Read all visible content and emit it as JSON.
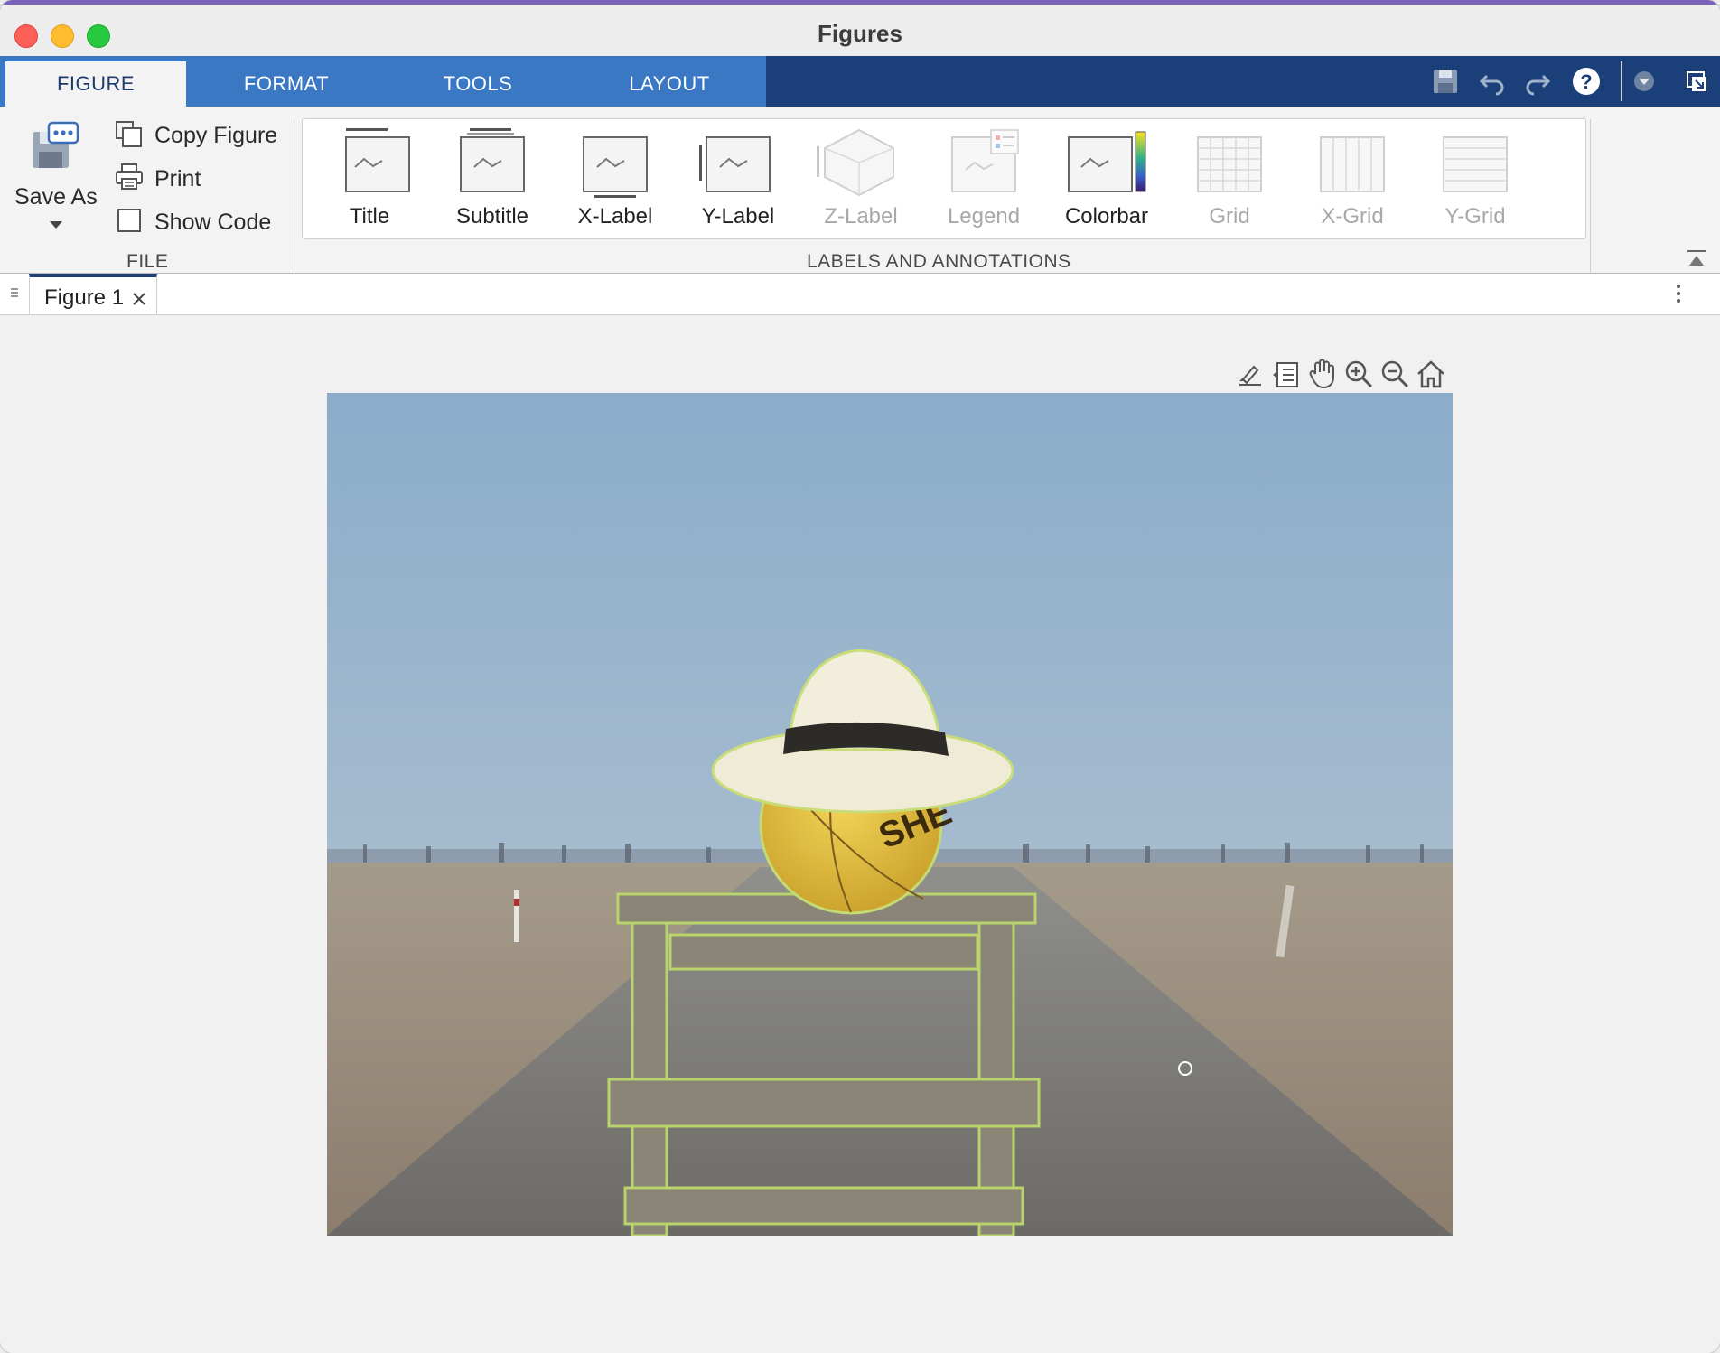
{
  "window": {
    "title": "Figures"
  },
  "tabs": [
    {
      "label": "FIGURE",
      "active": true
    },
    {
      "label": "FORMAT",
      "active": false
    },
    {
      "label": "TOOLS",
      "active": false
    },
    {
      "label": "LAYOUT",
      "active": false
    }
  ],
  "file_section": {
    "label": "FILE",
    "save_as": "Save As",
    "copy_figure": "Copy Figure",
    "print": "Print",
    "show_code": "Show Code",
    "show_code_checked": false
  },
  "labels_section": {
    "label": "LABELS AND ANNOTATIONS",
    "items": [
      {
        "label": "Title",
        "enabled": true,
        "icon": "title-icon"
      },
      {
        "label": "Subtitle",
        "enabled": true,
        "icon": "subtitle-icon"
      },
      {
        "label": "X-Label",
        "enabled": true,
        "icon": "xlabel-icon"
      },
      {
        "label": "Y-Label",
        "enabled": true,
        "icon": "ylabel-icon"
      },
      {
        "label": "Z-Label",
        "enabled": false,
        "icon": "zlabel-icon"
      },
      {
        "label": "Legend",
        "enabled": false,
        "icon": "legend-icon"
      },
      {
        "label": "Colorbar",
        "enabled": true,
        "icon": "colorbar-icon"
      },
      {
        "label": "Grid",
        "enabled": false,
        "icon": "grid-icon"
      },
      {
        "label": "X-Grid",
        "enabled": false,
        "icon": "xgrid-icon"
      },
      {
        "label": "Y-Grid",
        "enabled": false,
        "icon": "ygrid-icon"
      }
    ]
  },
  "document_tabs": [
    {
      "label": "Figure 1"
    }
  ],
  "figure": {
    "image_description_icons": [
      "brush-icon",
      "datatip-icon",
      "pan-icon",
      "zoom-in-icon",
      "zoom-out-icon",
      "home-icon"
    ],
    "image_text": "SHE"
  },
  "colors": {
    "tabbar": "#1b3f79",
    "tabstrip": "#3a78c3",
    "sky": "#8fb0cb",
    "road": "#7c7a74",
    "ball": "#e2bd3a"
  }
}
